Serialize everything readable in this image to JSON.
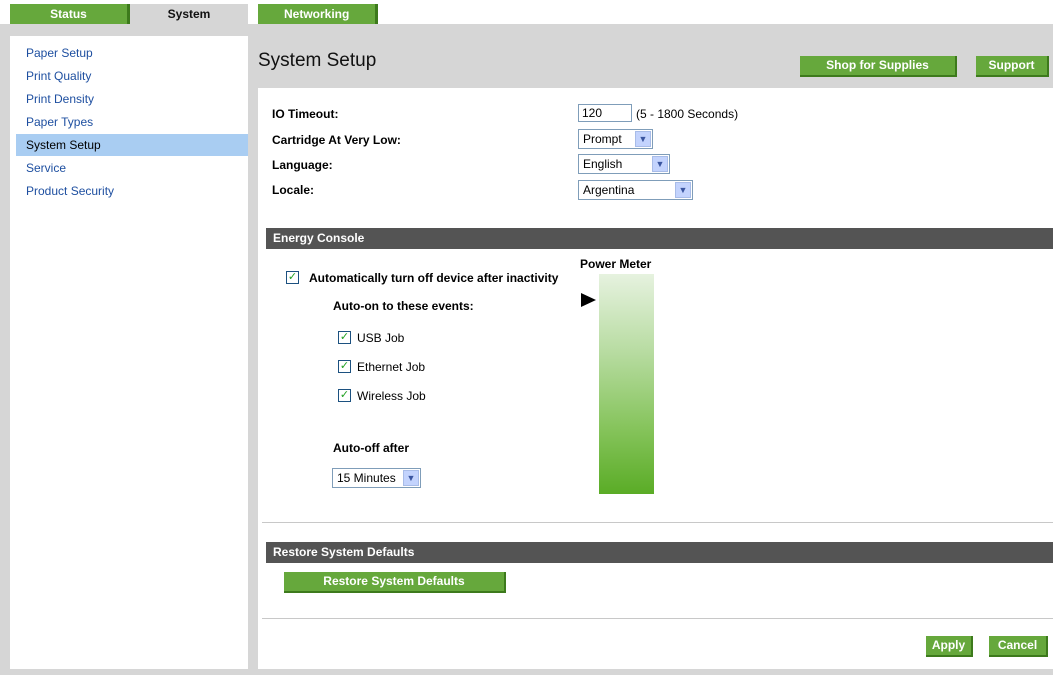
{
  "tabs": [
    {
      "label": "Status",
      "active": false
    },
    {
      "label": "System",
      "active": true
    },
    {
      "label": "Networking",
      "active": false
    }
  ],
  "sidebar": {
    "items": [
      {
        "label": "Paper Setup",
        "selected": false
      },
      {
        "label": "Print Quality",
        "selected": false
      },
      {
        "label": "Print Density",
        "selected": false
      },
      {
        "label": "Paper Types",
        "selected": false
      },
      {
        "label": "System Setup",
        "selected": true
      },
      {
        "label": "Service",
        "selected": false
      },
      {
        "label": "Product Security",
        "selected": false
      }
    ]
  },
  "header": {
    "title": "System Setup",
    "shop_label": "Shop for Supplies",
    "support_label": "Support"
  },
  "form": {
    "io_timeout": {
      "label": "IO Timeout:",
      "value": "120",
      "hint": "(5 - 1800 Seconds)"
    },
    "cartridge": {
      "label": "Cartridge At Very Low:",
      "value": "Prompt"
    },
    "language": {
      "label": "Language:",
      "value": "English"
    },
    "locale": {
      "label": "Locale:",
      "value": "Argentina"
    }
  },
  "energy": {
    "header": "Energy Console",
    "auto_off_label": "Automatically turn off device after inactivity",
    "auto_off_checked": true,
    "auto_on_label": "Auto-on to these events:",
    "events": [
      {
        "label": "USB Job",
        "checked": true
      },
      {
        "label": "Ethernet Job",
        "checked": true
      },
      {
        "label": "Wireless Job",
        "checked": true
      }
    ],
    "auto_off_after_label": "Auto-off after",
    "auto_off_after_value": "15 Minutes",
    "power_meter_label": "Power Meter"
  },
  "restore": {
    "header": "Restore System Defaults",
    "button_label": "Restore System Defaults"
  },
  "footer": {
    "apply_label": "Apply",
    "cancel_label": "Cancel"
  },
  "colors": {
    "accent_green": "#66a83c",
    "section_header": "#545454",
    "sidebar_selected": "#a9cdf2",
    "link_blue": "#1e4fa0"
  }
}
